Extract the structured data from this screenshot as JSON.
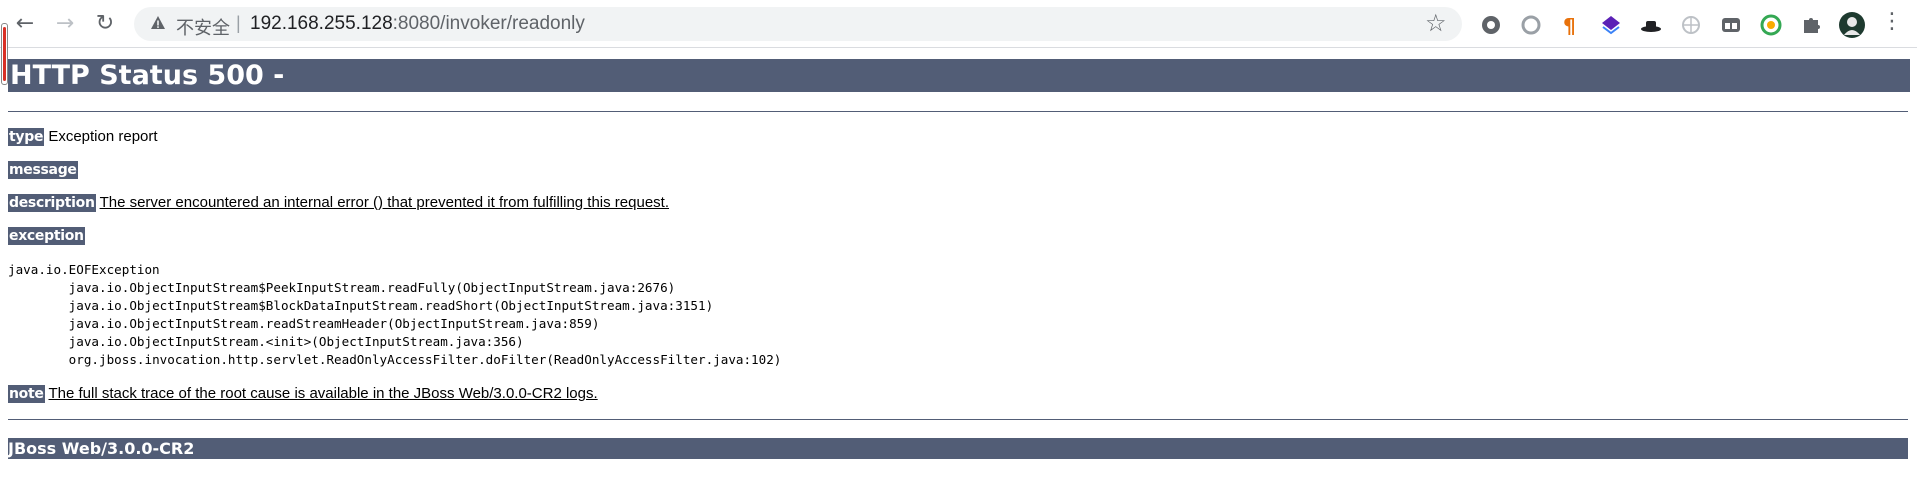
{
  "browser": {
    "insecure_label": "不安全",
    "separator": "|",
    "url_host": "192.168.255.128",
    "url_path": ":8080/invoker/readonly",
    "icons": {
      "back": "arrow-left-icon",
      "forward": "arrow-right-icon",
      "reload": "reload-icon",
      "warning": "warning-icon",
      "bookmark": "star-icon",
      "menu": "more-vert-icon"
    },
    "extension_colors": [
      "#5f6368",
      "#9aa0a6",
      "#e8710a",
      "#5b21b6",
      "#202124",
      "#bdc1c6",
      "#5f6368",
      "#f9ab00",
      "#5f6368"
    ]
  },
  "page": {
    "title": "HTTP Status 500 -",
    "type_label": "type",
    "type_value": "Exception report",
    "message_label": "message",
    "description_label": "description",
    "description_value": "The server encountered an internal error () that prevented it from fulfilling this request.",
    "exception_label": "exception",
    "stack_trace": "java.io.EOFException\n\tjava.io.ObjectInputStream$PeekInputStream.readFully(ObjectInputStream.java:2676)\n\tjava.io.ObjectInputStream$BlockDataInputStream.readShort(ObjectInputStream.java:3151)\n\tjava.io.ObjectInputStream.readStreamHeader(ObjectInputStream.java:859)\n\tjava.io.ObjectInputStream.<init>(ObjectInputStream.java:356)\n\torg.jboss.invocation.http.servlet.ReadOnlyAccessFilter.doFilter(ReadOnlyAccessFilter.java:102)",
    "note_label": "note",
    "note_value": "The full stack trace of the root cause is available in the JBoss Web/3.0.0-CR2 logs.",
    "footer": "JBoss Web/3.0.0-CR2",
    "accent_color": "#525d76"
  }
}
